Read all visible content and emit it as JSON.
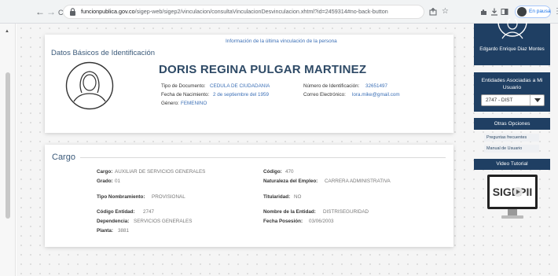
{
  "browser": {
    "url_domain": "funcionpublica.gov.co",
    "url_path": "/sigep-web/sigep2/vinculacion/consultaVinculacionDesvinculacion.xhtml?id=2459314#no-back-button",
    "back_glyph": "←",
    "forward_glyph": "→",
    "reload_glyph": "C",
    "profile_status": "En pausa",
    "icons": [
      "share-icon",
      "star-icon",
      "extensions-icon",
      "download-icon",
      "split-view-icon",
      "profile-icon",
      "menu-icon"
    ]
  },
  "basic_data": {
    "info_link": "Información de la última vinculación de la persona",
    "section_title": "Datos Básicos de Identificación",
    "person_name": "DORIS REGINA PULGAR MARTINEZ",
    "fields": {
      "tipo_documento_label": "Tipo de Documento:",
      "tipo_documento_value": "CEDULA DE CIUDADANIA",
      "fecha_nacimiento_label": "Fecha de Nacimiento:",
      "fecha_nacimiento_value": "2 de septiembre del 1959",
      "genero_label": "Género:",
      "genero_value": "FEMENINO",
      "numero_id_label": "Número de Identificación:",
      "numero_id_value": "32651497",
      "correo_label": "Correo Electrónico:",
      "correo_value": "lora.mike@gmail.com"
    }
  },
  "cargo": {
    "section_title": "Cargo",
    "fields": {
      "cargo_label": "Cargo:",
      "cargo_value": "AUXILIAR DE SERVICIOS GENERALES",
      "grado_label": "Grado:",
      "grado_value": "01",
      "tipo_nombramiento_label": "Tipo Nombramiento:",
      "tipo_nombramiento_value": "PROVISIONAL",
      "codigo_entidad_label": "Código Entidad:",
      "codigo_entidad_value": "2747",
      "dependencia_label": "Dependencia:",
      "dependencia_value": "SERVICIOS GENERALES",
      "planta_label": "Planta:",
      "planta_value": "3881",
      "codigo_label": "Código:",
      "codigo_value": "470",
      "naturaleza_label": "Naturaleza del Empleo:",
      "naturaleza_value": "CARRERA ADMINISTRATIVA",
      "titularidad_label": "Titularidad:",
      "titularidad_value": "NO",
      "nombre_entidad_label": "Nombre de la Entidad:",
      "nombre_entidad_value": "DISTRISEGURIDAD",
      "fecha_posesion_label": "Fecha Posesión:",
      "fecha_posesion_value": "03/06/2003"
    }
  },
  "sidebar": {
    "user_name": "Edgardo Enrique Diaz Montes",
    "entities_title": "Entidades Asociadas a Mi Usuario",
    "entity_selected": "2747 - DIST",
    "other_options_title": "Otras Opciones",
    "links": [
      "Preguntas frecuentes",
      "Manual de Usuario"
    ],
    "video_title": "Video Tutorial",
    "video_logo_text": "SIGEPII"
  },
  "colors": {
    "sidebar_bg": "#1f3f63",
    "name_color": "#2e4a66",
    "link_blue": "#3b6fb6"
  }
}
